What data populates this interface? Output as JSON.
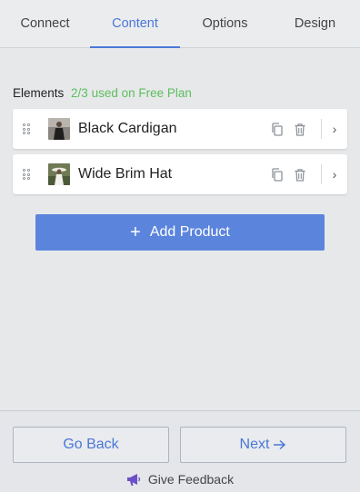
{
  "tabs": [
    {
      "label": "Connect",
      "active": false
    },
    {
      "label": "Content",
      "active": true
    },
    {
      "label": "Options",
      "active": false
    },
    {
      "label": "Design",
      "active": false
    }
  ],
  "elements": {
    "title": "Elements",
    "usage": "2/3 used on Free Plan",
    "items": [
      {
        "name": "Black Cardigan",
        "thumb_icon": "product-thumbnail"
      },
      {
        "name": "Wide Brim Hat",
        "thumb_icon": "product-thumbnail"
      }
    ]
  },
  "add_button": {
    "label": "Add Product",
    "icon": "plus-icon"
  },
  "footer": {
    "back_label": "Go Back",
    "next_label": "Next",
    "next_icon": "arrow-right-icon",
    "feedback_label": "Give Feedback",
    "feedback_icon": "megaphone-icon"
  },
  "colors": {
    "accent": "#4a78d6",
    "button": "#5b84dd",
    "usage_green": "#5cbf5c"
  }
}
